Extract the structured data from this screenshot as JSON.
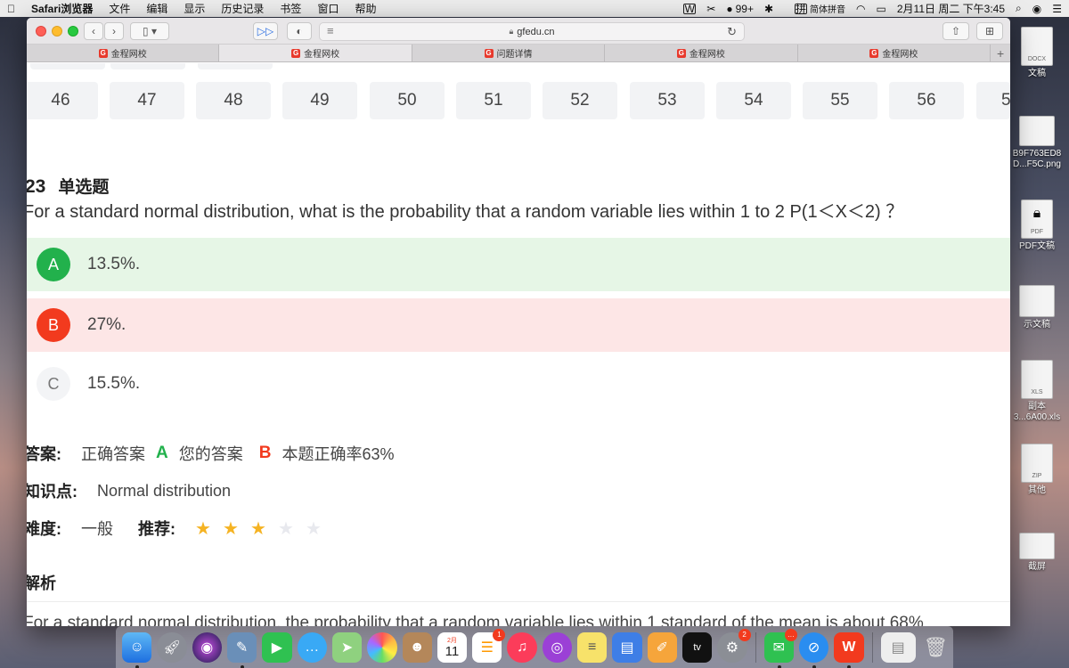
{
  "menubar": {
    "app": "Safari浏览器",
    "items": [
      "文件",
      "编辑",
      "显示",
      "历史记录",
      "书签",
      "窗口",
      "帮助"
    ],
    "status": {
      "badge_count": "99+",
      "input_method": "简体拼音",
      "datetime": "2月11日 周二 下午3:45"
    }
  },
  "safari": {
    "address": "gfedu.cn",
    "tabs": [
      "金程网校",
      "金程网校",
      "问题详情",
      "金程网校",
      "金程网校"
    ],
    "active_tab": 1
  },
  "question_nav": {
    "numbers": [
      "46",
      "47",
      "48",
      "49",
      "50",
      "51",
      "52",
      "53",
      "54",
      "55",
      "56",
      "5"
    ]
  },
  "question": {
    "number": "23",
    "type": "单选题",
    "text": "For a standard normal distribution, what is the probability that a random variable lies within 1 to 2 P(1＜X＜2) ？",
    "options": [
      {
        "letter": "A",
        "text": "13.5%.",
        "state": "correct"
      },
      {
        "letter": "B",
        "text": "27%.",
        "state": "wrong"
      },
      {
        "letter": "C",
        "text": "15.5%.",
        "state": "normal"
      }
    ]
  },
  "answer": {
    "label": "答案:",
    "correct_label": "正确答案",
    "correct_letter": "A",
    "your_label": "您的答案",
    "your_letter": "B",
    "accuracy": "本题正确率63%"
  },
  "knowledge": {
    "label": "知识点:",
    "value": "Normal distribution"
  },
  "difficulty": {
    "label": "难度:",
    "value": "一般",
    "recommend_label": "推荐:",
    "stars_on": 3,
    "stars_total": 5
  },
  "analysis": {
    "label": "解析",
    "text": "For a standard normal distribution, the probability that a random variable lies within 1 standard of the mean is about 68%"
  },
  "desktop": {
    "items": [
      "文稿",
      "B9F763ED8\nD...F5C.png",
      "PDF文稿",
      "示文稿",
      "副本\n3...6A00.xls",
      "其他",
      "截屏"
    ],
    "thumb_tags": [
      "DOCX",
      "",
      "PDF",
      "",
      "XLS",
      "ZIP",
      ""
    ]
  },
  "dock": {
    "calendar_month": "2月",
    "calendar_day": "11",
    "reminders_badge": "1",
    "prefs_badge": "2",
    "wechat_badge": "…",
    "appletv": "tv"
  }
}
